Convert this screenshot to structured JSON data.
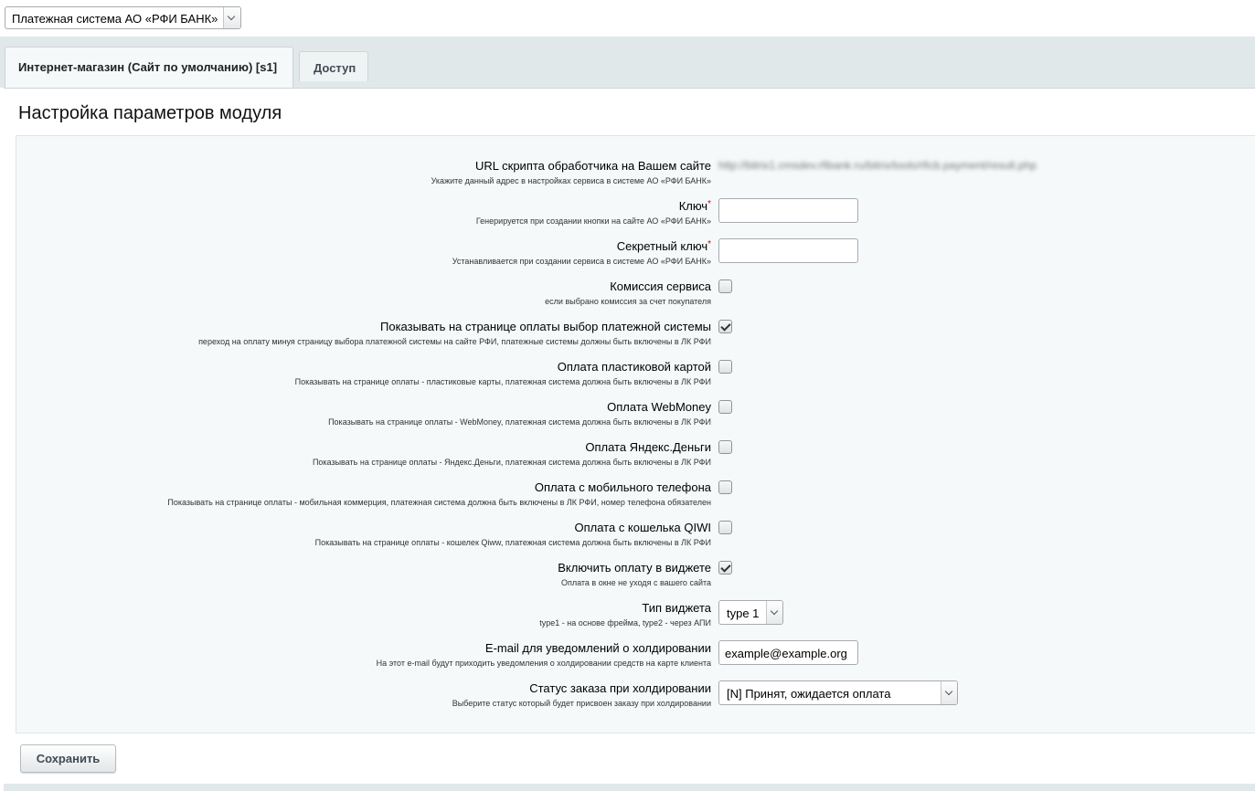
{
  "module_select": {
    "value": "Платежная система АО «РФИ БАНК»"
  },
  "tabs": [
    {
      "label": "Интернет-магазин (Сайт по умолчанию) [s1]",
      "active": true
    },
    {
      "label": "Доступ",
      "active": false
    }
  ],
  "page_title": "Настройка параметров модуля",
  "fields": {
    "url": {
      "label": "URL скрипта обработчика на Вашем сайте",
      "hint": "Укажите данный адрес в настройках сервиса в системе АО «РФИ БАНК»",
      "value": "http://bitrix1.cmsdev.rfibank.ru/bitrix/tools/rficb.payment/result.php"
    },
    "key": {
      "label": "Ключ",
      "required_mark": "*",
      "hint": "Генерируется при создании кнопки на сайте АО «РФИ БАНК»",
      "value": ""
    },
    "secret_key": {
      "label": "Секретный ключ",
      "required_mark": "*",
      "hint": "Устанавливается при создании сервиса в системе АО «РФИ БАНК»",
      "value": ""
    },
    "commission": {
      "label": "Комиссия сервиса",
      "hint": "если выбрано комиссия за счет покупателя",
      "checked": false
    },
    "show_choice": {
      "label": "Показывать на странице оплаты выбор платежной системы",
      "hint": "переход на оплату минуя страницу выбора платежной системы на сайте РФИ, платежные системы должны быть включены в ЛК РФИ",
      "checked": true
    },
    "card": {
      "label": "Оплата пластиковой картой",
      "hint": "Показывать на странице оплаты - пластиковые карты, платежная система должна быть включены в ЛК РФИ",
      "checked": false
    },
    "webmoney": {
      "label": "Оплата WebMoney",
      "hint": "Показывать на странице оплаты - WebMoney, платежная система должна быть включены в ЛК РФИ",
      "checked": false
    },
    "yandex": {
      "label": "Оплата Яндекс.Деньги",
      "hint": "Показывать на странице оплаты - Яндекс.Деньги, платежная система должна быть включены в ЛК РФИ",
      "checked": false
    },
    "mobile": {
      "label": "Оплата с мобильного телефона",
      "hint": "Показывать на странице оплаты - мобильная коммерция, платежная система должна быть включены в ЛК РФИ, номер телефона обязателен",
      "checked": false
    },
    "qiwi": {
      "label": "Оплата с кошелька QIWI",
      "hint": "Показывать на странице оплаты - кошелек Qiww, платежная система должна быть включены в ЛК РФИ",
      "checked": false
    },
    "widget": {
      "label": "Включить оплату в виджете",
      "hint": "Оплата в окне не уходя с вашего сайта",
      "checked": true
    },
    "widget_type": {
      "label": "Тип виджета",
      "hint": "type1 - на основе фрейма, type2 - через АПИ",
      "value": "type 1"
    },
    "hold_email": {
      "label": "E-mail для уведомлений о холдировании",
      "hint": "На этот e-mail будут приходить уведомления о холдировании средств на карте клиента",
      "value": "example@example.org"
    },
    "hold_status": {
      "label": "Статус заказа при холдировании",
      "hint": "Выберите статус который будет присвоен заказу при холдировании",
      "value": "[N] Принят, ожидается оплата"
    }
  },
  "save_button": {
    "label": "Сохранить"
  }
}
